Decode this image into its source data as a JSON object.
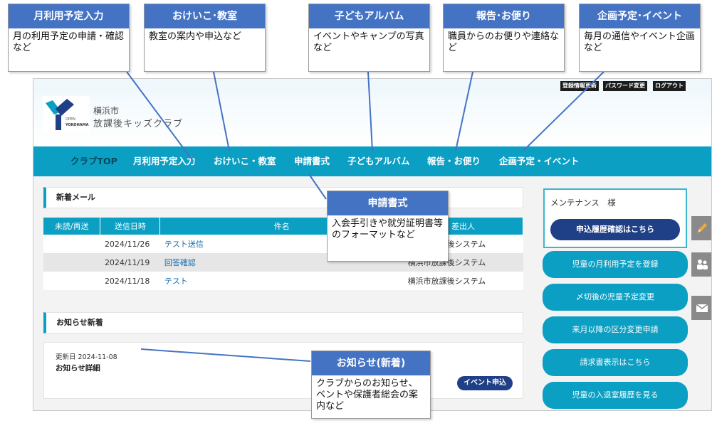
{
  "header": {
    "util_links": [
      "登録情報更新",
      "パスワード変更",
      "ログアウト"
    ],
    "logo_small_1": "OPEN",
    "logo_small_2": "YOKOHAMA",
    "city": "横浜市",
    "club": "放課後キッズクラブ"
  },
  "nav": [
    "クラブTOP",
    "月利用予定入力",
    "おけいこ・教室",
    "申請書式",
    "子どもアルバム",
    "報告・お便り",
    "企画予定・イベント"
  ],
  "mail": {
    "title": "新着メール",
    "columns": [
      "未読/再送",
      "送信日時",
      "件名",
      "差出人"
    ],
    "rows": [
      {
        "status": "",
        "date": "2024/11/26",
        "subject": "テスト送信",
        "sender": "横浜市放課後システム"
      },
      {
        "status": "",
        "date": "2024/11/19",
        "subject": "回答確認",
        "sender": "横浜市放課後システム"
      },
      {
        "status": "",
        "date": "2024/11/18",
        "subject": "テスト",
        "sender": "横浜市放課後システム"
      }
    ]
  },
  "news": {
    "title": "お知らせ新着",
    "date": "更新日 2024-11-08",
    "item": "お知らせ詳細",
    "event_button": "イベント申込"
  },
  "sidebar": {
    "user": "メンテナンス　様",
    "history_button": "申込履歴確認はこちら",
    "buttons": [
      "児童の月利用予定を登録",
      "〆切後の児童予定変更",
      "来月以降の区分変更申請",
      "請求書表示はこちら",
      "児童の入退室履歴を見る"
    ],
    "tab_icons": [
      "pencil-icon",
      "people-icon",
      "mail-icon"
    ]
  },
  "callouts": [
    {
      "title": "月利用予定入力",
      "body": "月の利用予定の申請・確認など"
    },
    {
      "title": "おけいこ･教室",
      "body": "教室の案内や申込など"
    },
    {
      "title": "子どもアルバム",
      "body": "イベントやキャンプの写真など"
    },
    {
      "title": "報告･お便り",
      "body": "職員からのお便りや連絡など"
    },
    {
      "title": "企画予定･イベント",
      "body": "毎月の通信やイベント企画など"
    },
    {
      "title": "申請書式",
      "body": "入会手引きや就労証明書等のフォーマットなど"
    },
    {
      "title": "お知らせ(新着)",
      "body": "クラブからのお知らせ、ベントや保護者総会の案内など"
    }
  ],
  "colors": {
    "nav": "#0b9fc3",
    "callout_head": "#4573c4",
    "dark_button": "#1f3f86"
  }
}
